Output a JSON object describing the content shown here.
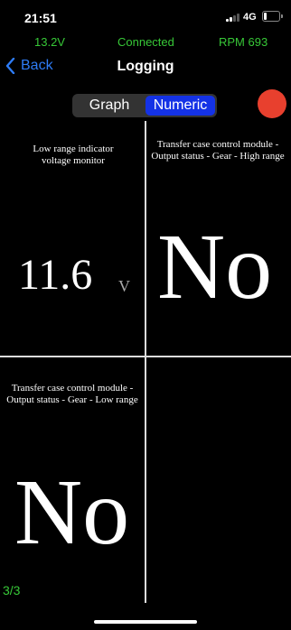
{
  "statusbar": {
    "time": "21:51",
    "network": "4G",
    "signal_icon": "signal-bars-icon",
    "battery_icon": "battery-icon"
  },
  "infobar": {
    "voltage": "13.2V",
    "connection": "Connected",
    "rpm": "RPM 693"
  },
  "nav": {
    "back_label": "Back",
    "title": "Logging"
  },
  "view_toggle": {
    "options": [
      "Graph",
      "Numeric"
    ],
    "selected": "Numeric"
  },
  "record_button_color": "#e8402e",
  "cells": [
    {
      "label": "Low range indicator voltage monitor",
      "value": "11.6",
      "unit": "V"
    },
    {
      "label": "Transfer case control module - Output status - Gear - High range",
      "value": "No"
    },
    {
      "label": "Transfer case control module - Output status - Gear - Low range",
      "value": "No"
    }
  ],
  "page_indicator": "3/3",
  "colors": {
    "accent_blue": "#2e7cf6",
    "status_green": "#37c837",
    "segment_selected": "#1432e6"
  }
}
